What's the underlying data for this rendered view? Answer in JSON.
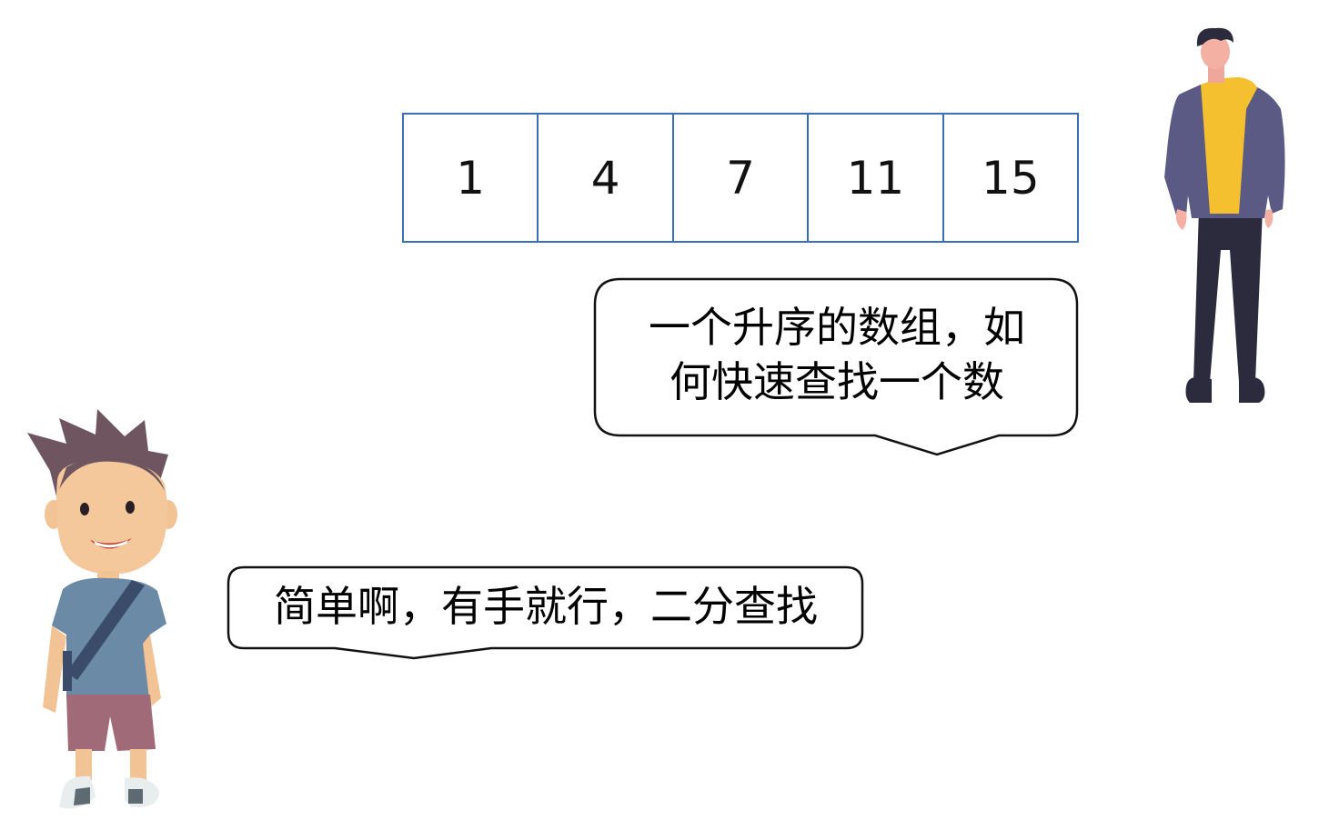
{
  "array": {
    "values": [
      "1",
      "4",
      "7",
      "11",
      "15"
    ]
  },
  "dialogue": {
    "question": "一个升序的数组，如\n何快速查找一个数",
    "answer": "简单啊，有手就行，二分查找"
  },
  "colors": {
    "array_border": "#3a6fb8",
    "bubble_border": "#111111"
  },
  "icons": {
    "right_person": "standing-man-hoodie-illustration",
    "left_person": "cartoon-boy-illustration"
  }
}
